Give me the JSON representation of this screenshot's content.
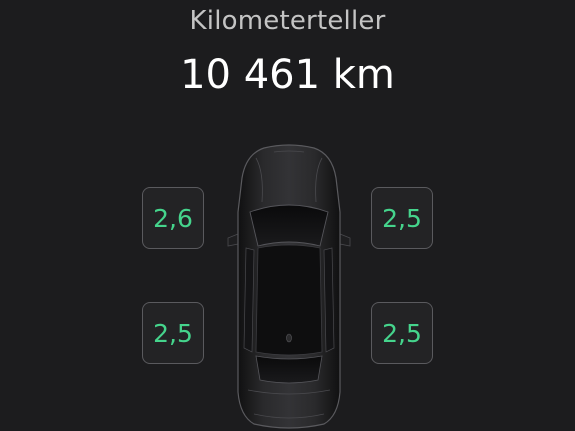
{
  "odometer": {
    "label": "Kilometerteller",
    "value": "10 461 km"
  },
  "tire_pressure": {
    "front_left": "2,6",
    "front_right": "2,5",
    "rear_left": "2,5",
    "rear_right": "2,5",
    "status_color": "#45d48c"
  },
  "icons": {
    "car": "car-top-view-icon"
  }
}
